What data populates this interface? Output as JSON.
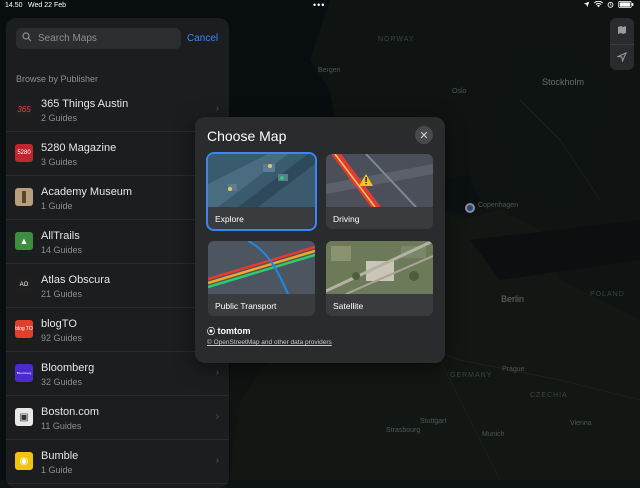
{
  "status_bar": {
    "time": "14.50",
    "date": "Wed 22 Feb",
    "more": "•••"
  },
  "sidebar": {
    "search_placeholder": "Search Maps",
    "cancel_label": "Cancel",
    "section_title": "Browse by Publisher",
    "items": [
      {
        "name": "365 Things Austin",
        "guides": "2 Guides",
        "logo_text": "365",
        "logo_color": "#1e1e1e",
        "logo_fg": "#e14a4a"
      },
      {
        "name": "5280 Magazine",
        "guides": "3 Guides",
        "logo_text": "5280",
        "logo_color": "#c0272d",
        "logo_fg": "#ffffff"
      },
      {
        "name": "Academy Museum",
        "guides": "1 Guide",
        "logo_text": "",
        "logo_color": "#b8a07a",
        "logo_fg": "#ffffff"
      },
      {
        "name": "AllTrails",
        "guides": "14 Guides",
        "logo_text": "▲",
        "logo_color": "#3e8e41",
        "logo_fg": "#ffffff"
      },
      {
        "name": "Atlas Obscura",
        "guides": "21 Guides",
        "logo_text": "AO",
        "logo_color": "#1e1e1e",
        "logo_fg": "#ffffff"
      },
      {
        "name": "blogTO",
        "guides": "92 Guides",
        "logo_text": "blog TO",
        "logo_color": "#e0402b",
        "logo_fg": "#ffffff"
      },
      {
        "name": "Bloomberg",
        "guides": "32 Guides",
        "logo_text": "Bloomberg",
        "logo_color": "#4b2bd1",
        "logo_fg": "#ffffff"
      },
      {
        "name": "Boston.com",
        "guides": "11 Guides",
        "logo_text": "▣",
        "logo_color": "#e8e8e8",
        "logo_fg": "#333333"
      },
      {
        "name": "Bumble",
        "guides": "1 Guide",
        "logo_text": "◉",
        "logo_color": "#f1c40f",
        "logo_fg": "#ffffff"
      }
    ]
  },
  "modal": {
    "title": "Choose Map",
    "options": [
      {
        "label": "Explore",
        "selected": true
      },
      {
        "label": "Driving",
        "selected": false
      },
      {
        "label": "Public Transport",
        "selected": false
      },
      {
        "label": "Satellite",
        "selected": false
      }
    ],
    "brand": "tomtom",
    "credit": "© OpenStreetMap and other data providers"
  },
  "map_labels": {
    "norway": "NORWAY",
    "bergen": "Bergen",
    "oslo": "Oslo",
    "stockholm": "Stockholm",
    "copenhagen": "Copenhagen",
    "berlin": "Berlin",
    "prague": "Prague",
    "munich": "Munich",
    "vienna": "Vienna",
    "strasbourg": "Strasbourg",
    "stuttgart": "Stuttgart",
    "poland": "POLAND",
    "germany": "GERMANY",
    "czechia": "CZECHIA"
  },
  "accent_color": "#3b86f7"
}
